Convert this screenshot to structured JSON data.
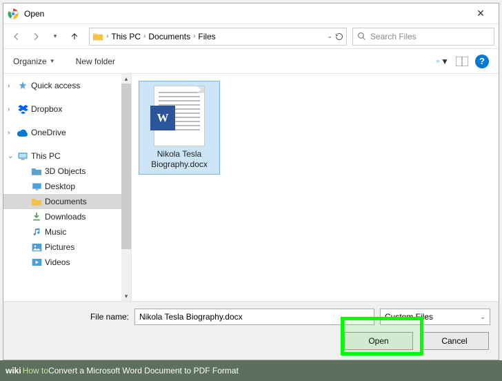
{
  "titlebar": {
    "title": "Open"
  },
  "nav": {
    "breadcrumb": [
      "This PC",
      "Documents",
      "Files"
    ],
    "search_placeholder": "Search Files"
  },
  "toolbar": {
    "organize": "Organize",
    "newfolder": "New folder"
  },
  "sidebar": {
    "quick": "Quick access",
    "dropbox": "Dropbox",
    "onedrive": "OneDrive",
    "thispc": "This PC",
    "items": [
      "3D Objects",
      "Desktop",
      "Documents",
      "Downloads",
      "Music",
      "Pictures",
      "Videos"
    ]
  },
  "file": {
    "name_display": "Nikola Tesla Biography.docx",
    "badge": "W"
  },
  "bottom": {
    "filename_label": "File name:",
    "filename_value": "Nikola Tesla Biography.docx",
    "filter": "Custom Files",
    "open": "Open",
    "cancel": "Cancel"
  },
  "caption": {
    "prefix": "wiki",
    "how": "How to ",
    "title": "Convert a Microsoft Word Document to PDF Format"
  }
}
